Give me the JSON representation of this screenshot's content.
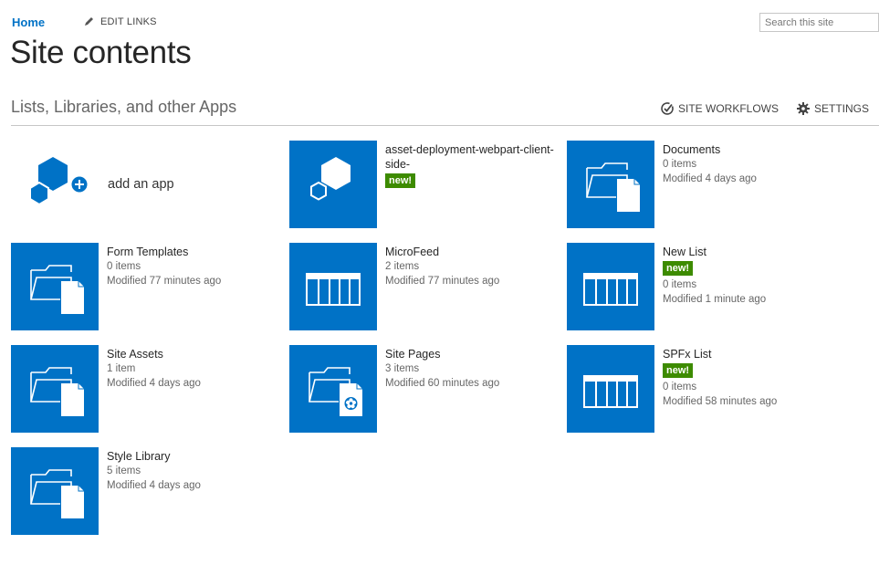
{
  "nav": {
    "home": "Home",
    "edit_links": "EDIT LINKS"
  },
  "search": {
    "placeholder": "Search this site"
  },
  "page": {
    "title": "Site contents"
  },
  "section": {
    "heading": "Lists, Libraries, and other Apps"
  },
  "actions": {
    "site_workflows": "SITE WORKFLOWS",
    "settings": "SETTINGS"
  },
  "colors": {
    "tile": "#0072c6",
    "badge": "#3d8b00",
    "link": "#0072c6"
  },
  "add_app": {
    "label": "add an app",
    "icon": "add-app-icon"
  },
  "tiles": [
    {
      "title": "asset-deployment-webpart-client-side-",
      "badge": "new!",
      "icon": "app-icon"
    },
    {
      "title": "Documents",
      "count": "0 items",
      "modified": "Modified 4 days ago",
      "icon": "document-library-icon"
    },
    {
      "title": "Form Templates",
      "count": "0 items",
      "modified": "Modified 77 minutes ago",
      "icon": "document-library-icon"
    },
    {
      "title": "MicroFeed",
      "count": "2 items",
      "modified": "Modified 77 minutes ago",
      "icon": "list-icon"
    },
    {
      "title": "New List",
      "badge": "new!",
      "count": "0 items",
      "modified": "Modified 1 minute ago",
      "icon": "list-icon"
    },
    {
      "title": "Site Assets",
      "count": "1 item",
      "modified": "Modified 4 days ago",
      "icon": "document-library-icon"
    },
    {
      "title": "Site Pages",
      "count": "3 items",
      "modified": "Modified 60 minutes ago",
      "icon": "site-pages-icon"
    },
    {
      "title": "SPFx List",
      "badge": "new!",
      "count": "0 items",
      "modified": "Modified 58 minutes ago",
      "icon": "list-icon"
    },
    {
      "title": "Style Library",
      "count": "5 items",
      "modified": "Modified 4 days ago",
      "icon": "document-library-icon"
    }
  ]
}
